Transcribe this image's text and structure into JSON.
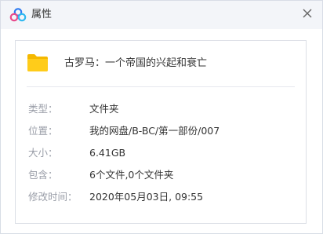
{
  "window": {
    "title": "属性",
    "app_icon": "baidu-netdisk-cloud-icon",
    "close_icon": "close-icon"
  },
  "item": {
    "icon": "folder-icon",
    "icon_color": "#ffc400",
    "name": "古罗马：一个帝国的兴起和衰亡"
  },
  "properties": [
    {
      "label": "类型：",
      "value": "文件夹"
    },
    {
      "label": "位置：",
      "value": "我的网盘/B-BC/第一部份/007"
    },
    {
      "label": "大小：",
      "value": "6.41GB"
    },
    {
      "label": "包含：",
      "value": "6个文件,0个文件夹"
    },
    {
      "label": "修改时间：",
      "value": "2020年05月03日, 09:55"
    }
  ]
}
